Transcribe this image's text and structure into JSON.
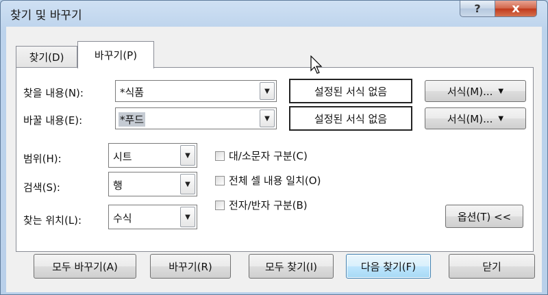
{
  "window": {
    "title": "찾기 및 바꾸기",
    "help_label": "?",
    "close_label": "x"
  },
  "tabs": [
    {
      "label": "찾기(D)",
      "active": false
    },
    {
      "label": "바꾸기(P)",
      "active": true
    }
  ],
  "find": {
    "label": "찾을 내용(N):",
    "value": "*식품",
    "format_preview": "설정된 서식 없음",
    "format_button": "서식(M)..."
  },
  "replace": {
    "label": "바꿀 내용(E):",
    "value": "*푸드",
    "format_preview": "설정된 서식 없음",
    "format_button": "서식(M)..."
  },
  "options": {
    "within_label": "범위(H):",
    "within_value": "시트",
    "search_label": "검색(S):",
    "search_value": "행",
    "lookin_label": "찾는 위치(L):",
    "lookin_value": "수식",
    "match_case": "대/소문자 구분(C)",
    "match_entire": "전체 셀 내용 일치(O)",
    "match_byte": "전자/반자 구분(B)",
    "options_button": "옵션(T) <<"
  },
  "buttons": {
    "replace_all": "모두 바꾸기(A)",
    "replace": "바꾸기(R)",
    "find_all": "모두 찾기(I)",
    "find_next": "다음 찾기(F)",
    "close": "닫기"
  },
  "colors": {
    "title_bar": "#bcd3ec",
    "close_button": "#c0391c",
    "focus_border": "#3c7fb1"
  }
}
